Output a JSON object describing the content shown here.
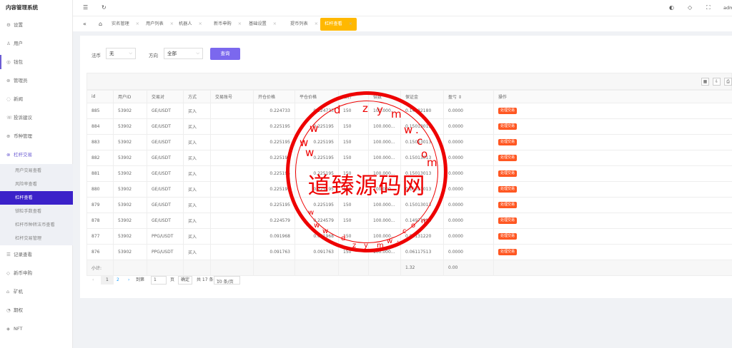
{
  "app": {
    "title": "内容管理系统",
    "user": "adm"
  },
  "sidebar": {
    "items_top": [
      {
        "label": "设置",
        "icon": "gear-icon",
        "glyph": "⚙"
      },
      {
        "label": "用户",
        "icon": "user-icon",
        "glyph": "♙"
      },
      {
        "label": "钱包",
        "icon": "wallet-icon",
        "glyph": "◎"
      },
      {
        "label": "管理员",
        "icon": "admin-icon",
        "glyph": "⊛"
      },
      {
        "label": "新闻",
        "icon": "news-icon",
        "glyph": "◌"
      },
      {
        "label": "投诉建议",
        "icon": "feedback-icon",
        "glyph": "☏"
      },
      {
        "label": "币种管理",
        "icon": "coin-icon",
        "glyph": "⊕"
      },
      {
        "label": "杠杆交易",
        "icon": "leverage-icon",
        "glyph": "⊗"
      }
    ],
    "sub_items": [
      "用户交易查看",
      "风险率查看",
      "杠杆查看",
      "锁粒手数查看",
      "杠杆币种转法币查看",
      "杠杆交易管理"
    ],
    "items_bottom": [
      {
        "label": "记录查看",
        "icon": "record-icon",
        "glyph": "☰"
      },
      {
        "label": "新币申购",
        "icon": "new-coin-icon",
        "glyph": "◇"
      },
      {
        "label": "矿机",
        "icon": "miner-icon",
        "glyph": "⌂"
      },
      {
        "label": "期权",
        "icon": "option-icon",
        "glyph": "◔"
      },
      {
        "label": "NFT",
        "icon": "nft-icon",
        "glyph": "◈"
      }
    ]
  },
  "tabs": [
    {
      "label": "实名管理"
    },
    {
      "label": "用户列表"
    },
    {
      "label": "机器人"
    },
    {
      "label": "新币申购"
    },
    {
      "label": "基础设置"
    },
    {
      "label": "提币列表"
    },
    {
      "label": "杠杆查看"
    }
  ],
  "filters": {
    "legal_label": "法币",
    "legal_value": "无",
    "direction_label": "方向",
    "direction_value": "全部",
    "search_button": "查询"
  },
  "table": {
    "headers": [
      "id",
      "用户ID",
      "交易对",
      "方式",
      "交易账号",
      "开仓价格",
      "平仓价格",
      "杠杆",
      "倍数",
      "保证金",
      "盈亏 ⇕",
      "操作"
    ],
    "rows": [
      [
        "885",
        "53902",
        "GE/USDT",
        "买入",
        "",
        "0.224733",
        "0.224733",
        "150",
        "100.000…",
        "0.14982180",
        "0.0000",
        "处理交易"
      ],
      [
        "884",
        "53902",
        "GE/USDT",
        "买入",
        "",
        "0.225195",
        "0.225195",
        "150",
        "100.000…",
        "0.15013013",
        "0.0000",
        "处理交易"
      ],
      [
        "883",
        "53902",
        "GE/USDT",
        "买入",
        "",
        "0.225195",
        "0.225195",
        "150",
        "100.000…",
        "0.15013013",
        "0.0000",
        "处理交易"
      ],
      [
        "882",
        "53902",
        "GE/USDT",
        "买入",
        "",
        "0.225195",
        "0.225195",
        "150",
        "100.000…",
        "0.15013013",
        "0.0000",
        "处理交易"
      ],
      [
        "881",
        "53902",
        "GE/USDT",
        "买入",
        "",
        "0.225195",
        "0.225195",
        "150",
        "100.000…",
        "0.15013013",
        "0.0000",
        "处理交易"
      ],
      [
        "880",
        "53902",
        "GE/USDT",
        "买入",
        "",
        "0.225195",
        "0.225195",
        "150",
        "100.000…",
        "0.15013013",
        "0.0000",
        "处理交易"
      ],
      [
        "879",
        "53902",
        "GE/USDT",
        "买入",
        "",
        "0.225195",
        "0.225195",
        "150",
        "100.000…",
        "0.15013013",
        "0.0000",
        "处理交易"
      ],
      [
        "878",
        "53902",
        "GE/USDT",
        "买入",
        "",
        "0.224579",
        "0.224579",
        "150",
        "100.000…",
        "0.14971913",
        "0.0000",
        "处理交易"
      ],
      [
        "877",
        "53902",
        "PPG/USDT",
        "买入",
        "",
        "0.091968",
        "0.091968",
        "150",
        "100.000…",
        "0.06131220",
        "0.0000",
        "处理交易"
      ],
      [
        "876",
        "53902",
        "PPG/USDT",
        "买入",
        "",
        "0.091763",
        "0.091763",
        "150",
        "100.000…",
        "0.06117513",
        "0.0000",
        "处理交易"
      ]
    ],
    "summary": {
      "label": "小计:",
      "margin": "1.32",
      "pnl": "0.00"
    }
  },
  "pager": {
    "page1": "1",
    "page2": "2",
    "goto_label": "到第",
    "goto_value": "1",
    "page_unit": "页",
    "confirm": "确定",
    "total": "共 17 条",
    "per_page": "10 条/页"
  },
  "watermark": {
    "text": "道臻源码网",
    "letters": [
      "w",
      "d",
      "z",
      "y",
      "m",
      "w",
      ".",
      "c",
      "w",
      "o",
      "w",
      "m",
      "w",
      "w",
      "w",
      "d",
      "z",
      "y",
      "m",
      "w",
      ".",
      "c",
      "o",
      "m"
    ]
  }
}
